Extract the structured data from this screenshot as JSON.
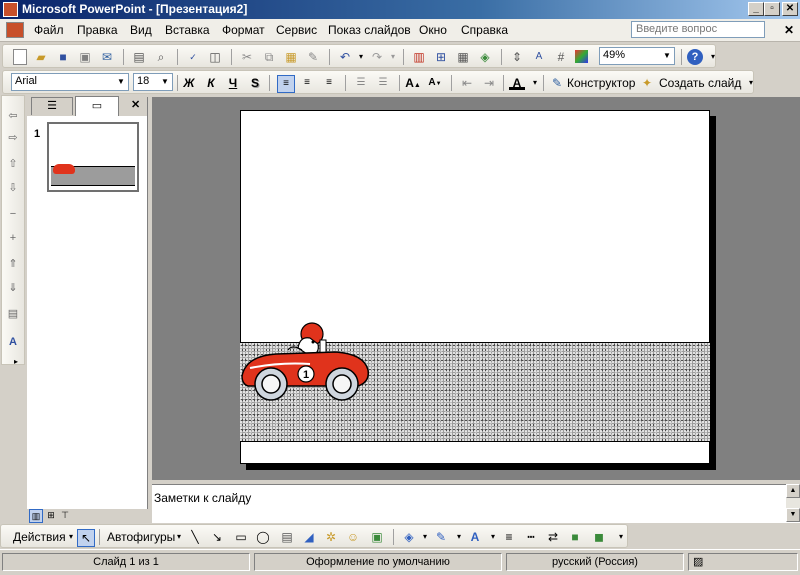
{
  "window": {
    "title": "Microsoft PowerPoint - [Презентация2]",
    "minimize": "_",
    "maximize": "▫",
    "close": "✕"
  },
  "menu": {
    "items": [
      "Файл",
      "Правка",
      "Вид",
      "Вставка",
      "Формат",
      "Сервис",
      "Показ слайдов",
      "Окно",
      "Справка"
    ],
    "help_placeholder": "Введите вопрос",
    "doc_close": "✕"
  },
  "toolbar_standard": {
    "zoom": "49%"
  },
  "toolbar_formatting": {
    "font": "Arial",
    "size": "18",
    "bold": "Ж",
    "italic": "К",
    "underline": "Ч",
    "shadow": "S",
    "designer": "Конструктор",
    "new_slide": "Создать слайд"
  },
  "outline_panel": {
    "slide_number": "1",
    "close": "✕"
  },
  "notes": {
    "placeholder": "Заметки к слайду"
  },
  "drawing": {
    "actions": "Действия",
    "autoshapes": "Автофигуры"
  },
  "car": {
    "number": "1",
    "body_color": "#e0331c"
  },
  "status": {
    "slide": "Слайд 1 из 1",
    "design": "Оформление по умолчанию",
    "language": "русский (Россия)"
  }
}
